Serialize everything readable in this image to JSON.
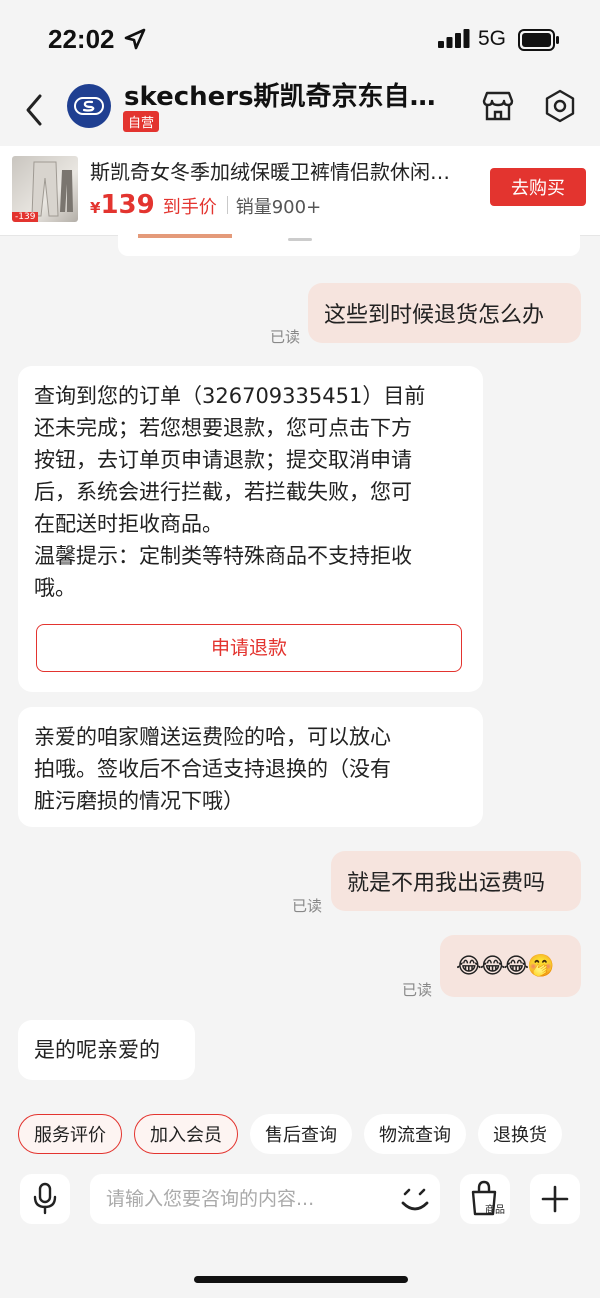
{
  "status_bar": {
    "time": "22:02",
    "network": "5G"
  },
  "header": {
    "shop_name": "skechers斯凯奇京东自营旗舰店",
    "badge": "自营",
    "icons": {
      "back": "back-chevron-icon",
      "store": "store-icon",
      "settings": "hexagon-settings-icon"
    }
  },
  "product": {
    "title": "斯凯奇女冬季加绒保暖卫裤情侣款休闲运动裤",
    "currency": "¥",
    "price": "139",
    "price_label": "到手价",
    "sales": "销量900+",
    "buy_label": "去购买",
    "thumb_tag": "-139"
  },
  "messages": [
    {
      "side": "out",
      "text": "这些到时候退货怎么办",
      "read": "已读"
    },
    {
      "side": "in",
      "lines": [
        "查询到您的订单（326709335451）目前",
        "还未完成；若您想要退款，您可点击下方",
        "按钮，去订单页申请退款；提交取消申请",
        "后，系统会进行拦截，若拦截失败，您可",
        "在配送时拒收商品。",
        "温馨提示：定制类等特殊商品不支持拒收",
        "哦。"
      ],
      "button": "申请退款"
    },
    {
      "side": "in",
      "lines": [
        "亲爱的咱家赠送运费险的哈，可以放心",
        "拍哦。签收后不合适支持退换的（没有",
        "脏污磨损的情况下哦）"
      ]
    },
    {
      "side": "out",
      "text": "就是不用我出运费吗",
      "read": "已读"
    },
    {
      "side": "out",
      "text": "😂😂😂🤭",
      "read": "已读"
    },
    {
      "side": "in",
      "lines": [
        "是的呢亲爱的"
      ]
    }
  ],
  "quick_replies": [
    "服务评价",
    "加入会员",
    "售后查询",
    "物流查询",
    "退换货"
  ],
  "input": {
    "placeholder": "请输入您要咨询的内容...",
    "goods_label": "商品",
    "icons": {
      "mic": "microphone-icon",
      "emoji": "emoji-icon",
      "goods": "shopping-bag-icon",
      "plus": "plus-icon"
    }
  },
  "colors": {
    "accent": "#e3342f",
    "outgoing_bubble": "#f6e4de",
    "background": "#f4f4f4",
    "brand_logo": "#1f3f91"
  }
}
